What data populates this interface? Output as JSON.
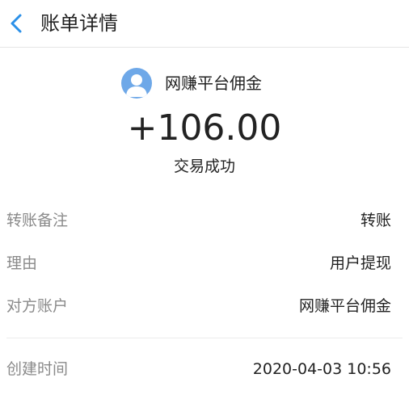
{
  "header": {
    "title": "账单详情",
    "back_icon": "chevron-left-icon",
    "accent_color": "#2b90e8"
  },
  "summary": {
    "avatar_icon": "user-avatar-icon",
    "payee": "网赚平台佣金",
    "amount": "+106.00",
    "status": "交易成功"
  },
  "details": [
    {
      "label": "转账备注",
      "value": "转账"
    },
    {
      "label": "理由",
      "value": "用户提现"
    },
    {
      "label": "对方账户",
      "value": "网赚平台佣金"
    }
  ],
  "created": {
    "label": "创建时间",
    "value": "2020-04-03 10:56"
  }
}
